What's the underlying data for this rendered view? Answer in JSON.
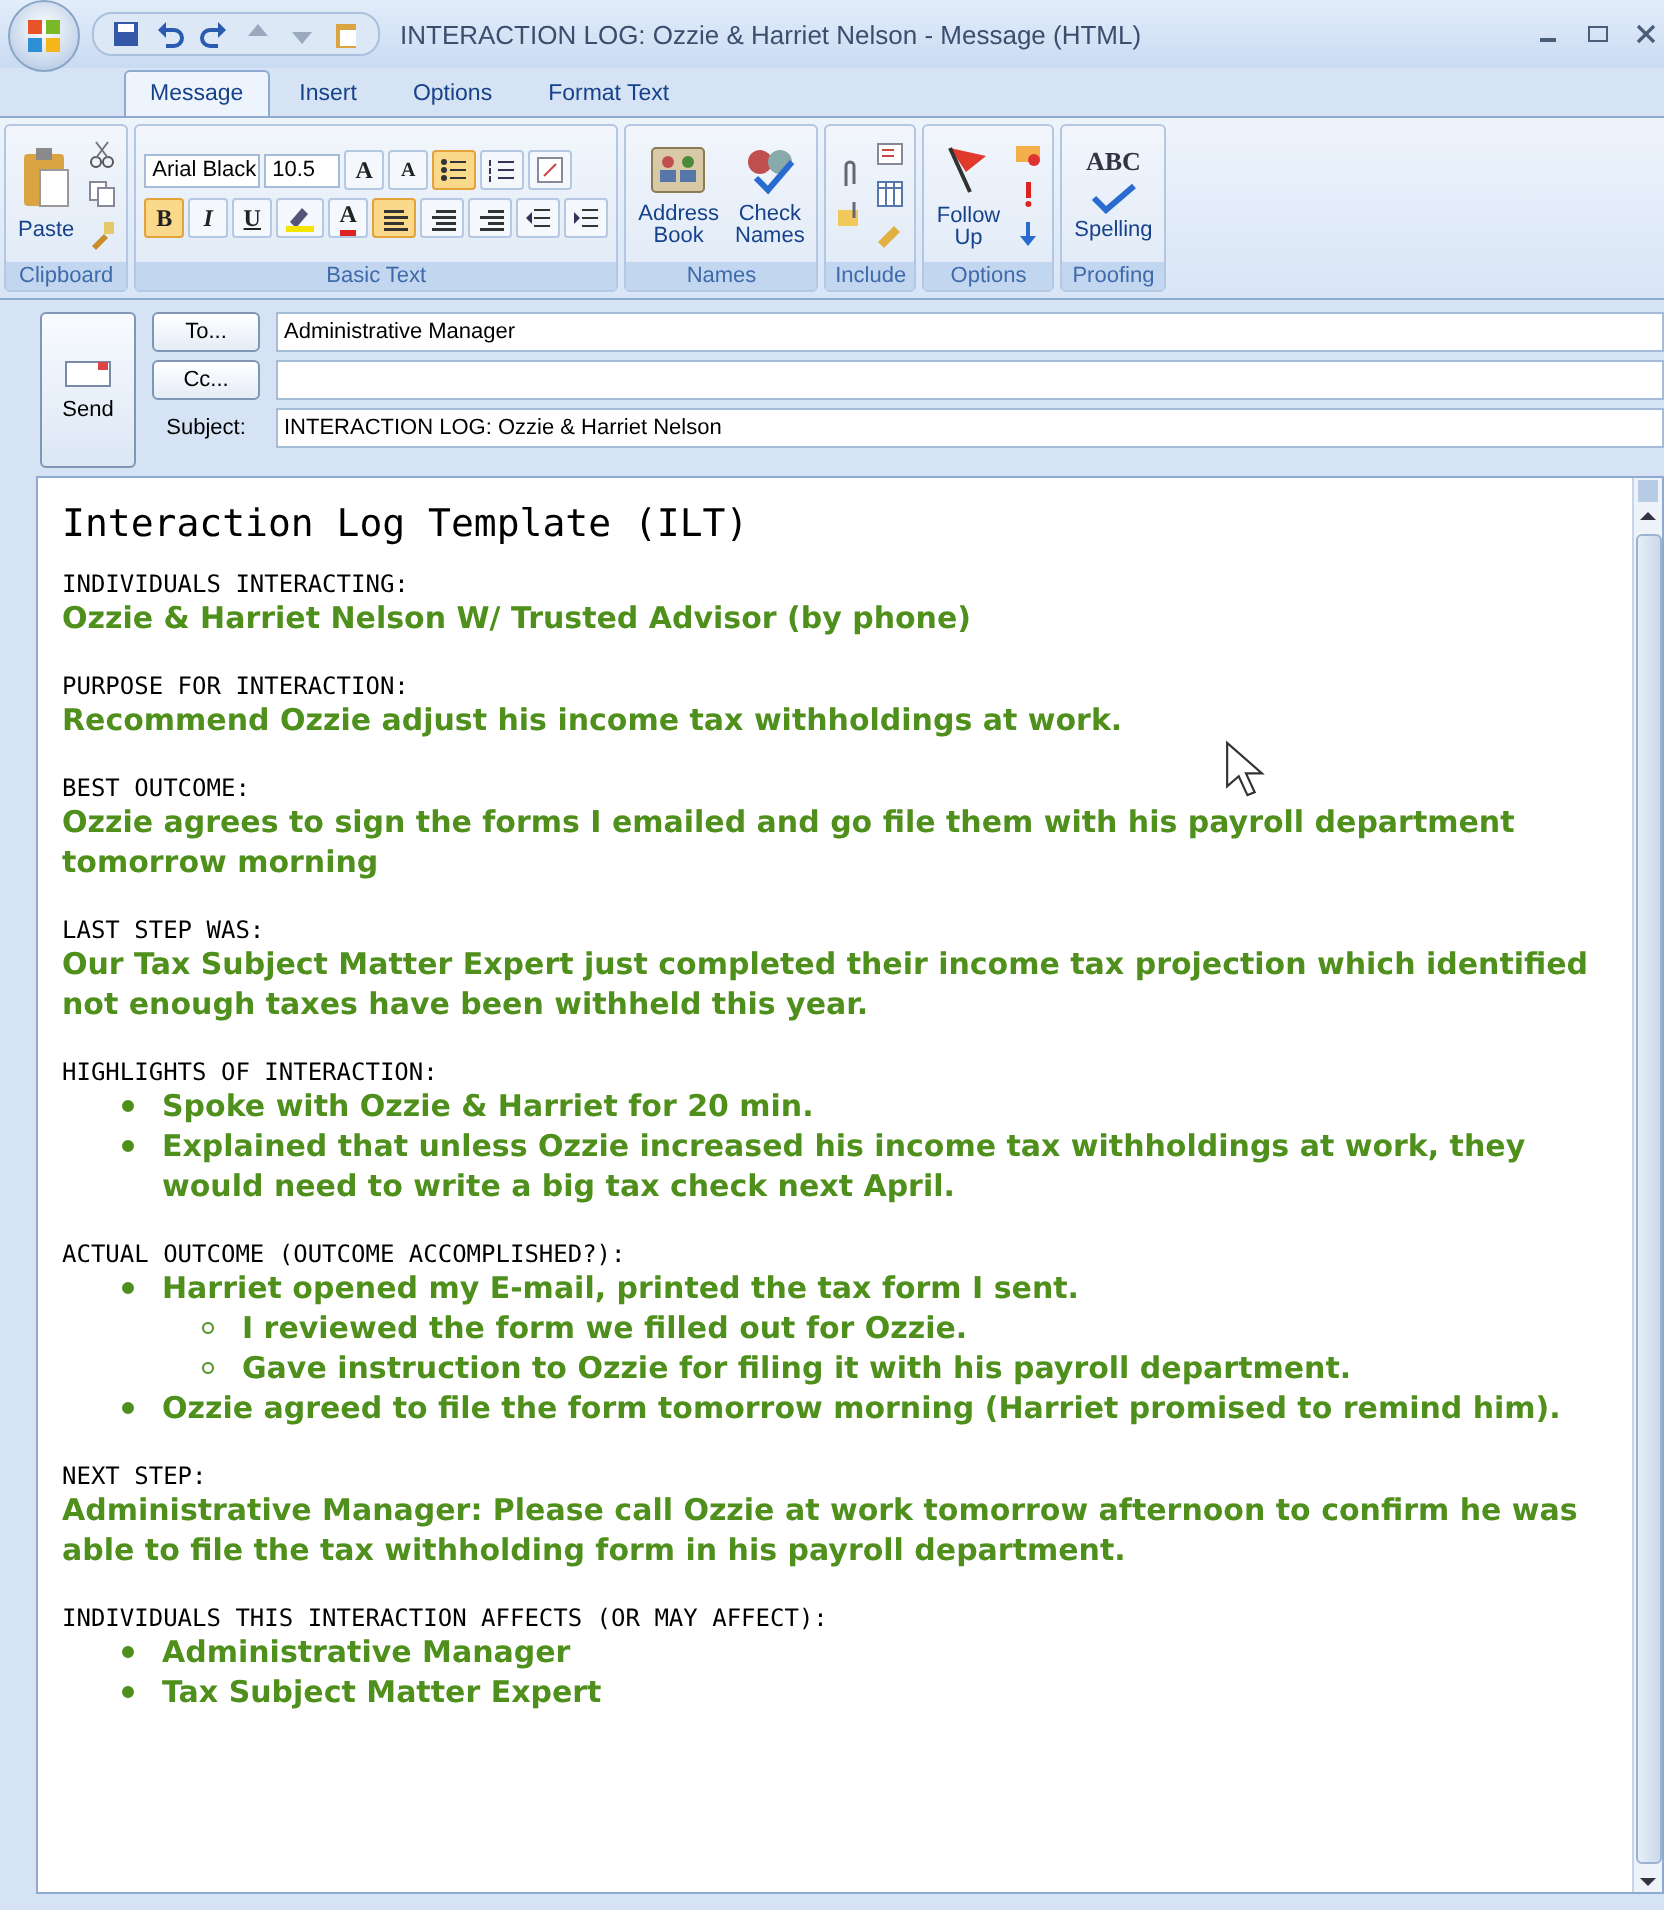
{
  "window": {
    "title": "INTERACTION LOG: Ozzie & Harriet Nelson - Message (HTML)"
  },
  "tabs": [
    {
      "label": "Message",
      "selected": true
    },
    {
      "label": "Insert",
      "selected": false
    },
    {
      "label": "Options",
      "selected": false
    },
    {
      "label": "Format Text",
      "selected": false
    }
  ],
  "ribbon": {
    "clipboard": {
      "paste": "Paste",
      "group": "Clipboard"
    },
    "basic_text": {
      "font": "Arial Black",
      "size": "10.5",
      "group": "Basic Text",
      "grow": "A",
      "shrink": "A",
      "color_letter": "A",
      "format_buttons": [
        {
          "label": "B",
          "selected": true
        },
        {
          "label": "I",
          "selected": false
        },
        {
          "label": "U",
          "selected": false
        }
      ],
      "align_buttons": [
        {
          "kind": "left",
          "selected": true
        },
        {
          "kind": "center",
          "selected": false
        },
        {
          "kind": "right",
          "selected": false
        }
      ],
      "bullets_selected": true
    },
    "names": {
      "group": "Names",
      "buttons": [
        {
          "line1": "Address",
          "line2": "Book"
        },
        {
          "line1": "Check",
          "line2": "Names"
        }
      ]
    },
    "include": {
      "group": "Include"
    },
    "options": {
      "group": "Options",
      "follow": "Follow",
      "up": "Up"
    },
    "proofing": {
      "group": "Proofing",
      "abc": "ABC",
      "spelling": "Spelling"
    }
  },
  "header": {
    "send": "Send",
    "to_button": "To...",
    "to": "Administrative Manager",
    "cc_button": "Cc...",
    "subject_label": "Subject:",
    "subject": "INTERACTION LOG: Ozzie & Harriet Nelson"
  },
  "body": {
    "title": "Interaction Log Template (ILT)",
    "sections": [
      {
        "heading": "INDIVIDUALS INTERACTING:",
        "text": "Ozzie & Harriet Nelson W/ Trusted Advisor (by phone)"
      },
      {
        "heading": "PURPOSE FOR INTERACTION:",
        "text": "Recommend Ozzie adjust his income tax withholdings at work."
      },
      {
        "heading": "BEST OUTCOME:",
        "text": "Ozzie agrees to sign the forms I emailed and go file them with his payroll department tomorrow morning"
      },
      {
        "heading": "LAST STEP WAS:",
        "text": "Our Tax Subject Matter Expert just completed their income tax projection which identified not enough taxes have been withheld this year."
      },
      {
        "heading": "HIGHLIGHTS OF INTERACTION:",
        "bullets": [
          {
            "text": "Spoke with Ozzie & Harriet for 20 min."
          },
          {
            "text": "Explained that unless Ozzie increased his income tax withholdings at work, they would need to write a big tax check next April."
          }
        ]
      },
      {
        "heading": "ACTUAL OUTCOME  (OUTCOME ACCOMPLISHED?):",
        "bullets": [
          {
            "text": "Harriet opened my E-mail, printed the tax form I sent.",
            "children": [
              {
                "text": "I reviewed the form we filled out for Ozzie."
              },
              {
                "text": "Gave instruction to Ozzie for filing it with his payroll department."
              }
            ]
          },
          {
            "text": "Ozzie agreed to file the form tomorrow morning (Harriet promised to remind him)."
          }
        ]
      },
      {
        "heading": "NEXT STEP:",
        "text": "Administrative Manager: Please call Ozzie at work tomorrow afternoon to confirm he was able to file the tax withholding form in his payroll department."
      },
      {
        "heading": "INDIVIDUALS THIS INTERACTION AFFECTS (OR MAY AFFECT):",
        "bullets": [
          {
            "text": "Administrative Manager"
          },
          {
            "text": "Tax Subject Matter Expert"
          }
        ]
      }
    ]
  }
}
